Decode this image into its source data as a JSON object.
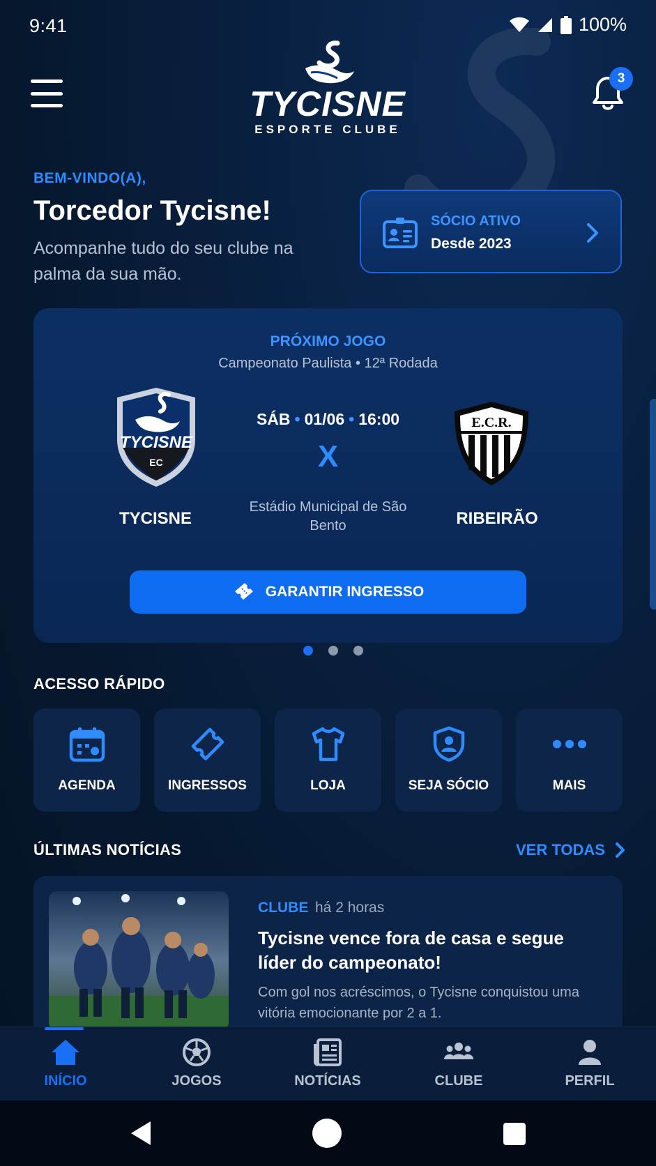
{
  "status_bar": {
    "time": "9:41",
    "battery": "100%"
  },
  "header": {
    "logo_title": "TYCISNE",
    "logo_subtitle": "ESPORTE CLUBE",
    "notification_count": "3"
  },
  "welcome": {
    "kicker": "BEM-VINDO(A),",
    "title": "Torcedor Tycisne!",
    "text": "Acompanhe tudo do seu clube na palma da sua mão."
  },
  "membership": {
    "label": "SÓCIO ATIVO",
    "since": "Desde 2023"
  },
  "next_match": {
    "kicker": "PRÓXIMO JOGO",
    "competition": "Campeonato Paulista • 12ª Rodada",
    "day": "SÁB",
    "date": "01/06",
    "time": "16:00",
    "vs": "X",
    "venue": "Estádio Municipal de São Bento",
    "home_team": "TYCISNE",
    "home_crest_text": "TYCISNE",
    "home_crest_sub": "EC",
    "away_team": "RIBEIRÃO",
    "away_crest_text": "E.C.R.",
    "ticket_button": "GARANTIR INGRESSO"
  },
  "carousel": {
    "count": 3,
    "active": 0
  },
  "quick_access": {
    "title": "ACESSO RÁPIDO",
    "items": [
      {
        "label": "AGENDA",
        "icon": "calendar-icon"
      },
      {
        "label": "INGRESSOS",
        "icon": "ticket-icon"
      },
      {
        "label": "LOJA",
        "icon": "shirt-icon"
      },
      {
        "label": "SEJA SÓCIO",
        "icon": "shield-user-icon"
      },
      {
        "label": "MAIS",
        "icon": "more-dots-icon"
      }
    ]
  },
  "news": {
    "title": "ÚLTIMAS NOTÍCIAS",
    "see_all": "VER TODAS",
    "items": [
      {
        "category": "CLUBE",
        "time": "há 2 horas",
        "headline": "Tycisne vence fora de casa e segue líder do campeonato!",
        "summary": "Com gol nos acréscimos, o Tycisne conquistou uma vitória emocionante por 2 a 1."
      }
    ]
  },
  "bottom_nav": {
    "items": [
      {
        "label": "INÍCIO",
        "icon": "home-icon",
        "active": true
      },
      {
        "label": "JOGOS",
        "icon": "soccer-ball-icon",
        "active": false
      },
      {
        "label": "NOTÍCIAS",
        "icon": "newspaper-icon",
        "active": false
      },
      {
        "label": "CLUBE",
        "icon": "group-icon",
        "active": false
      },
      {
        "label": "PERFIL",
        "icon": "user-icon",
        "active": false
      }
    ]
  },
  "colors": {
    "accent": "#1a6ff5",
    "accent_text": "#2e8cff",
    "background": "#06182f",
    "card": "#0c2f63"
  }
}
